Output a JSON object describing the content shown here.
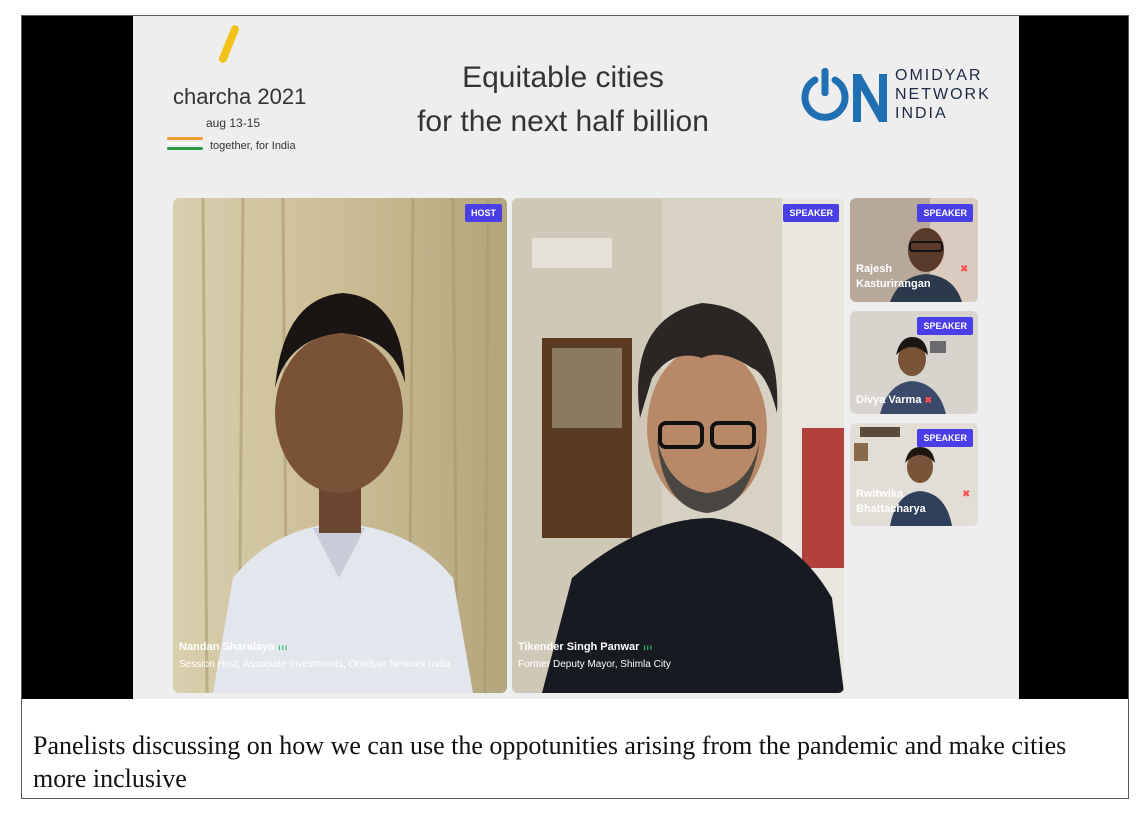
{
  "event": {
    "name": "charcha 2021",
    "dates": "aug 13-15",
    "tagline": "together, for India",
    "accent_color": "#f2c21a"
  },
  "session": {
    "title_line1": "Equitable cities",
    "title_line2": "for the next half billion"
  },
  "organizer": {
    "logo_mark": "ON",
    "name_line1": "OMIDYAR",
    "name_line2": "NETWORK",
    "name_line3": "INDIA",
    "brand_color": "#1f6fb2"
  },
  "participants": [
    {
      "role": "HOST",
      "name": "Nandan Sharalaya",
      "subtitle": "Session Host, Associate Investments, Omidyar Network India",
      "speaking_indicator": "signal-bars-icon"
    },
    {
      "role": "SPEAKER",
      "name": "Tikender Singh Panwar",
      "subtitle": "Former Deputy Mayor, Shimla City",
      "speaking_indicator": "signal-bars-icon"
    },
    {
      "role": "SPEAKER",
      "name_line1": "Rajesh",
      "name_line2": "Kasturirangan",
      "status_icon": "mic-muted-icon"
    },
    {
      "role": "SPEAKER",
      "name": "Divya Varma",
      "status_icon": "mic-muted-icon"
    },
    {
      "role": "SPEAKER",
      "name_line1": "Rwitwika",
      "name_line2": "Bhattacharya",
      "status_icon": "mic-muted-icon"
    }
  ],
  "caption": "Panelists discussing on how we can use the oppotunities arising from the pandemic and make cities more inclusive",
  "colors": {
    "role_badge": "#4a3ee6",
    "stage_bg": "#eeeeee"
  }
}
